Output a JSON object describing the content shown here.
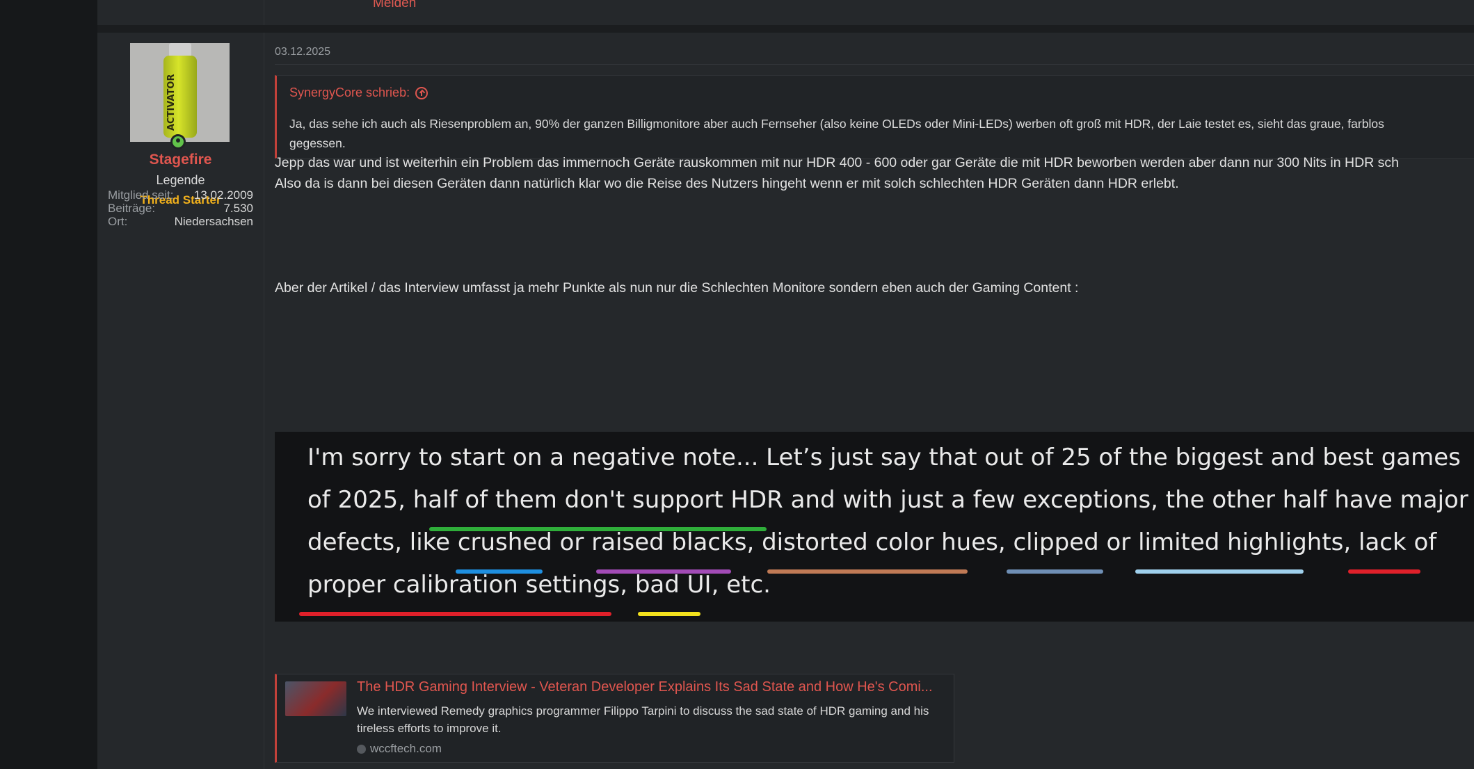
{
  "previous_post": {
    "report_label": "Melden"
  },
  "post": {
    "date": "03.12.2025",
    "user": {
      "name": "Stagefire",
      "title": "Legende",
      "badge": "Thread Starter",
      "avatar_text": "ACTIVATOR",
      "info": [
        {
          "label": "Mitglied seit:",
          "value": "13.02.2009"
        },
        {
          "label": "Beiträge:",
          "value": "7.530"
        },
        {
          "label": "Ort:",
          "value": "Niedersachsen"
        }
      ]
    },
    "quote": {
      "author": "SynergyCore schrieb:",
      "text": "Ja, das sehe ich auch als Riesenproblem an, 90% der ganzen Billigmonitore aber auch Fernseher (also keine OLEDs oder Mini-LEDs) werben oft groß mit HDR, der Laie testet es, sieht das graue, farblos\ngegessen."
    },
    "paragraphs": [
      "Jepp das war und ist weiterhin ein Problem das immernoch Geräte rauskommen mit nur HDR 400 - 600 oder gar Geräte die mit HDR beworben werden aber dann nur 300 Nits in HDR sch",
      "Also da is dann bei diesen Geräten dann natürlich klar wo die Reise des Nutzers hingeht wenn er mit solch schlechten HDR Geräten dann HDR erlebt.",
      "Aber der Artikel / das Interview umfasst ja mehr Punkte als nun nur die Schlechten Monitore sondern eben auch der Gaming Content :"
    ],
    "embedded_image": {
      "lines": [
        "I'm sorry to start on a negative note... Let’s just say that out of 25 of the biggest and best games",
        "of 2025, half of them don't support HDR and with just a few exceptions, the other half have major",
        "defects, like crushed or raised blacks, distorted color hues, clipped or limited highlights, lack of",
        "proper calibration settings, bad UI, etc."
      ],
      "underline_colors": [
        "#2fae3a",
        "#1e8fe0",
        "#a24bb6",
        "#c07a55",
        "#6f8fb5",
        "#9fd0ec",
        "#e0202a",
        "#f2e11d"
      ]
    },
    "link_card": {
      "title": "The HDR Gaming Interview - Veteran Developer Explains Its Sad State and How He's Comi...",
      "description": "We interviewed Remedy graphics programmer Filippo Tarpini to discuss the sad state of HDR gaming and his tireless efforts to improve it.",
      "domain": "wccftech.com"
    }
  }
}
